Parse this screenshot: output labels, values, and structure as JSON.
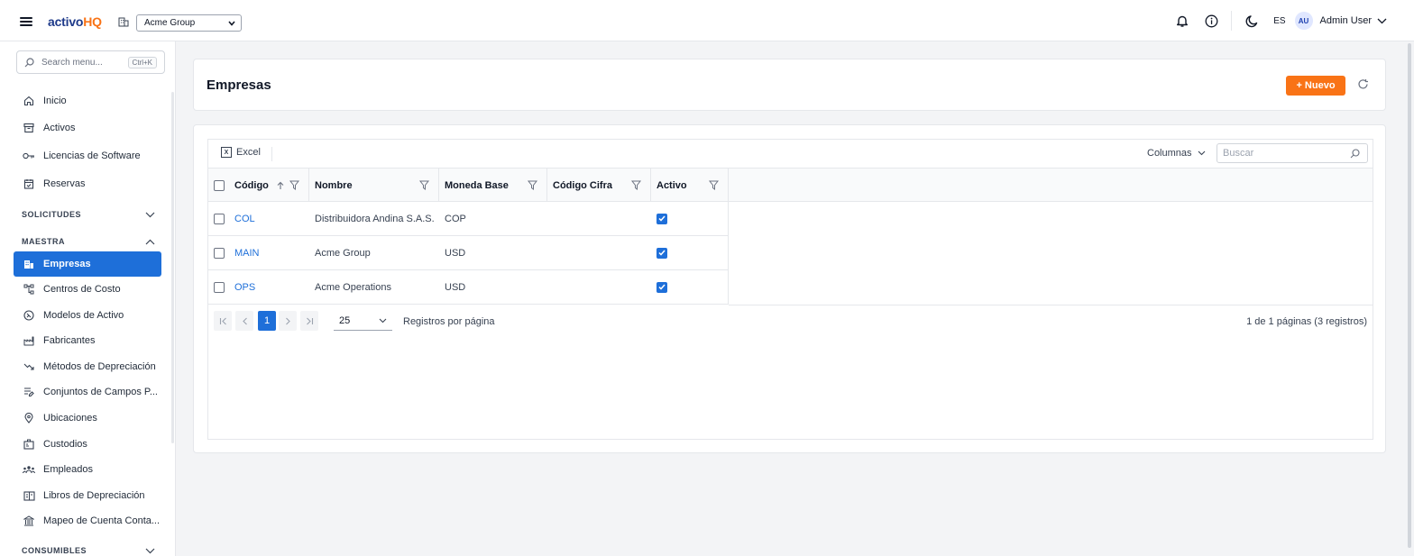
{
  "app": {
    "logo_part1": "activo",
    "logo_part2": "HQ",
    "company": "Acme Group"
  },
  "topbar": {
    "lang": "ES",
    "avatar": "AU",
    "user": "Admin User",
    "icons": [
      "menu-icon",
      "building-icon",
      "bell-icon",
      "info-icon",
      "moon-icon",
      "chevron-down-icon"
    ]
  },
  "sidebar": {
    "search_placeholder": "Search menu...",
    "search_shortcut": "Ctrl+K",
    "items_top": [
      {
        "label": "Inicio",
        "icon": "home-icon"
      },
      {
        "label": "Activos",
        "icon": "archive-icon"
      },
      {
        "label": "Licencias de Software",
        "icon": "key-icon"
      },
      {
        "label": "Reservas",
        "icon": "calendar-check-icon"
      }
    ],
    "section_solicitudes": "SOLICITUDES",
    "section_maestra": "MAESTRA",
    "items_maestra": [
      {
        "label": "Empresas",
        "icon": "building-icon"
      },
      {
        "label": "Centros de Costo",
        "icon": "network-icon"
      },
      {
        "label": "Modelos de Activo",
        "icon": "model-icon"
      },
      {
        "label": "Fabricantes",
        "icon": "factory-icon"
      },
      {
        "label": "Métodos de Depreciación",
        "icon": "trending-down-icon"
      },
      {
        "label": "Conjuntos de Campos P...",
        "icon": "form-icon"
      },
      {
        "label": "Ubicaciones",
        "icon": "map-pin-icon"
      },
      {
        "label": "Custodios",
        "icon": "badge-icon"
      },
      {
        "label": "Empleados",
        "icon": "users-icon"
      },
      {
        "label": "Libros de Depreciación",
        "icon": "book-icon"
      },
      {
        "label": "Mapeo de Cuenta Conta...",
        "icon": "bank-icon"
      }
    ],
    "section_consumibles": "CONSUMIBLES"
  },
  "page": {
    "title": "Empresas",
    "new_button": "+ Nuevo"
  },
  "grid": {
    "excel": "Excel",
    "columns_btn": "Columnas",
    "search_placeholder": "Buscar",
    "headers": {
      "codigo": "Código",
      "nombre": "Nombre",
      "moneda": "Moneda Base",
      "cifra": "Código Cifra",
      "activo": "Activo"
    },
    "rows": [
      {
        "codigo": "COL",
        "nombre": "Distribuidora Andina S.A.S.",
        "moneda": "COP",
        "cifra": "",
        "activo": true
      },
      {
        "codigo": "MAIN",
        "nombre": "Acme Group",
        "moneda": "USD",
        "cifra": "",
        "activo": true
      },
      {
        "codigo": "OPS",
        "nombre": "Acme Operations",
        "moneda": "USD",
        "cifra": "",
        "activo": true
      }
    ],
    "pager": {
      "current_page": "1",
      "page_size": "25",
      "per_page_label": "Registros por página",
      "info": "1 de 1 páginas (3 registros)"
    }
  },
  "colors": {
    "brand_blue": "#1e3a8a",
    "brand_orange": "#f97316",
    "accent": "#1e6fd9"
  }
}
